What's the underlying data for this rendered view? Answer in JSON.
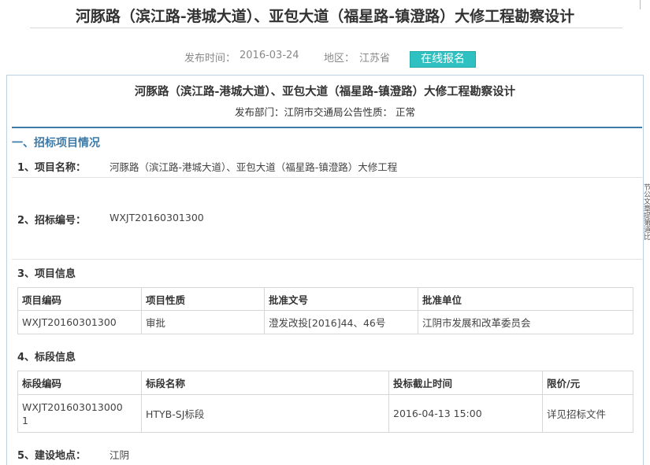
{
  "header": {
    "title": "河豚路（滨江路-港城大道）、亚包大道（福星路-镇澄路）大修工程勘察设计",
    "publish_time_label": "发布时间：",
    "publish_time": "2016-03-24",
    "region_label": "地区：",
    "region": "江苏省",
    "signup_button": "在线报名"
  },
  "document": {
    "title": "河豚路（滨江路-港城大道）、亚包大道（福星路-镇澄路）大修工程勘察设计",
    "subtitle": "发布部门：江阴市交通局公告性质：  正常",
    "side_text": "节公文章提第道比"
  },
  "section1": {
    "heading": "一、招标项目情况",
    "item1_label": "1、项目名称：",
    "item1_value": "河豚路（滨江路-港城大道）、亚包大道（福星路-镇澄路）大修工程",
    "item2_label": "2、招标编号：",
    "item2_value": "WXJT20160301300",
    "item3_label": "3、项目信息",
    "project_table": {
      "headers": [
        "项目编码",
        "项目性质",
        "批准文号",
        "批准单位"
      ],
      "rows": [
        [
          "WXJT20160301300",
          "审批",
          "澄发改投[2016]44、46号",
          "江阴市发展和改革委员会"
        ]
      ]
    },
    "item4_label": "4、标段信息",
    "section_table": {
      "headers": [
        "标段编码",
        "标段名称",
        "投标截止时间",
        "限价/元"
      ],
      "rows": [
        [
          "WXJT201603013000\n1",
          "HTYB-SJ标段",
          "2016-04-13 15:00",
          "详见招标文件"
        ]
      ]
    },
    "item5_label": "5、建设地点：",
    "item5_value": "江阴"
  }
}
